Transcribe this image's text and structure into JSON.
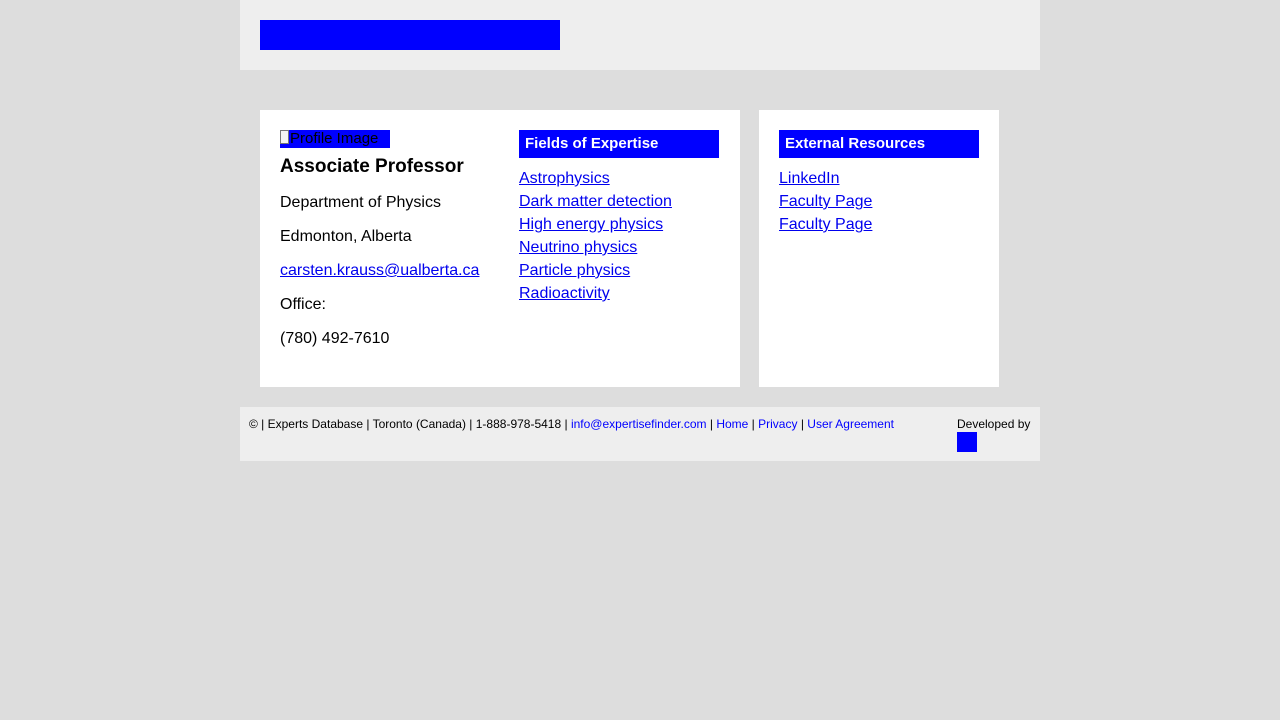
{
  "colors": {
    "background": "#dddddd",
    "panel": "#eeeeee",
    "card": "#ffffff",
    "accent": "#0000ff",
    "link": "#0000ee"
  },
  "profile": {
    "image_alt": "Profile Image",
    "title": "Associate Professor",
    "department": "Department of Physics",
    "location": "Edmonton, Alberta",
    "email": "carsten.krauss@ualberta.ca",
    "office": "Office:",
    "phone": "(780) 492-7610"
  },
  "expertise": {
    "heading": "Fields of Expertise",
    "items": [
      "Astrophysics",
      "Dark matter detection",
      "High energy physics",
      "Neutrino physics",
      "Particle physics",
      "Radioactivity"
    ]
  },
  "resources": {
    "heading": "External Resources",
    "items": [
      "LinkedIn",
      "Faculty Page",
      "Faculty Page"
    ]
  },
  "footer": {
    "text_prefix": "© | Experts Database | Toronto (Canada) | 1-888-978-5418 | ",
    "email": "info@expertisefinder.com",
    "sep": " | ",
    "home": "Home",
    "privacy": "Privacy",
    "agreement": "User Agreement",
    "developed_by": "Developed by"
  }
}
